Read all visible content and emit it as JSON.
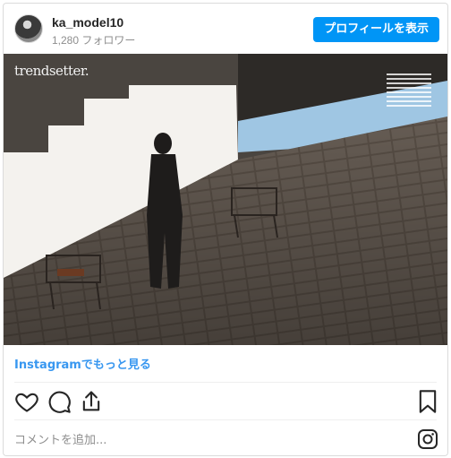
{
  "header": {
    "username": "ka_model10",
    "followers": "1,280 フォロワー",
    "profile_button": "プロフィールを表示"
  },
  "photo": {
    "brand_text": "trendsetter."
  },
  "footer": {
    "more_link": "Instagramでもっと見る",
    "comment_placeholder": "コメントを追加..."
  },
  "icons": {
    "like": "heart-icon",
    "comment": "comment-icon",
    "share": "share-icon",
    "save": "bookmark-icon",
    "instagram": "instagram-icon"
  },
  "colors": {
    "accent": "#0095f6",
    "link": "#3897f0"
  }
}
